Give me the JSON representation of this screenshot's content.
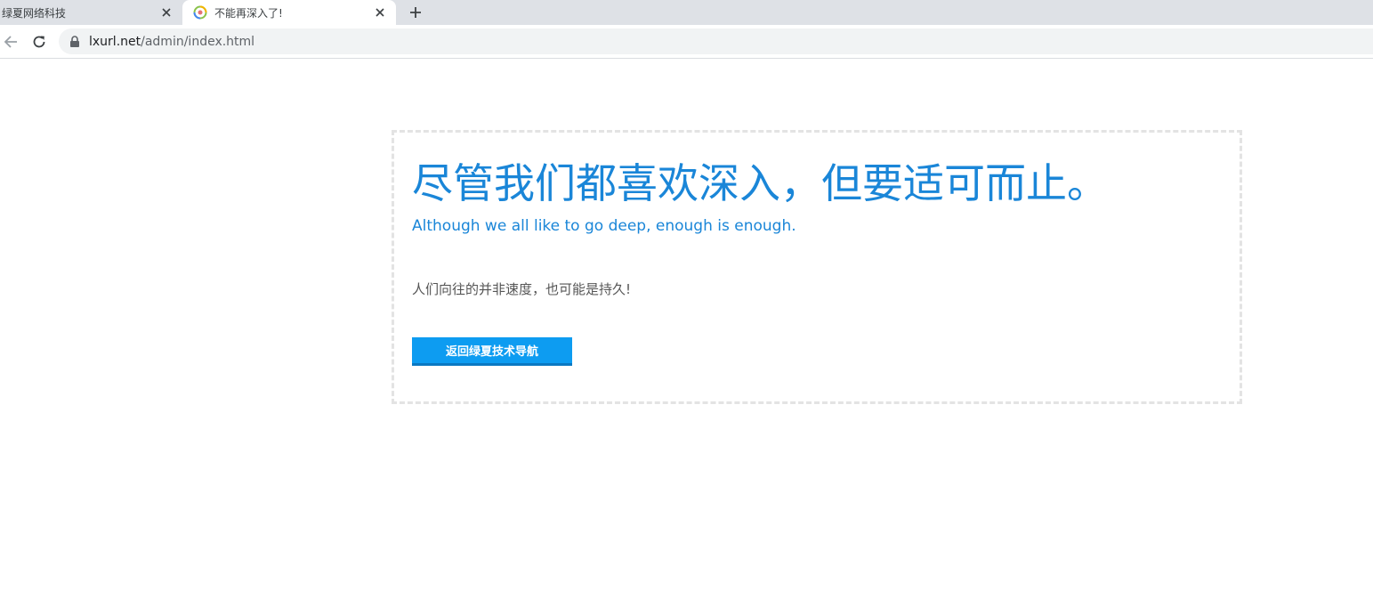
{
  "browser": {
    "tabs": [
      {
        "title": "绿夏网络科技",
        "active": false
      },
      {
        "title": "不能再深入了!",
        "active": true
      }
    ],
    "address": {
      "host": "lxurl.net",
      "path": "/admin/index.html"
    },
    "icons": {
      "back": "arrow-left-icon",
      "reload": "reload-icon",
      "secure": "lock-icon",
      "close": "close-icon",
      "new_tab": "plus-icon"
    }
  },
  "page": {
    "headline": "尽管我们都喜欢深入，但要适可而止。",
    "subline": "Although we all like to go deep, enough is enough.",
    "description": "人们向往的并非速度，也可能是持久!",
    "back_button": "返回绿夏技术导航"
  },
  "colors": {
    "accent": "#1a86d8",
    "button": "#0d9cf1",
    "button_border": "#0a78c2",
    "box_border": "#e3e3e3"
  }
}
